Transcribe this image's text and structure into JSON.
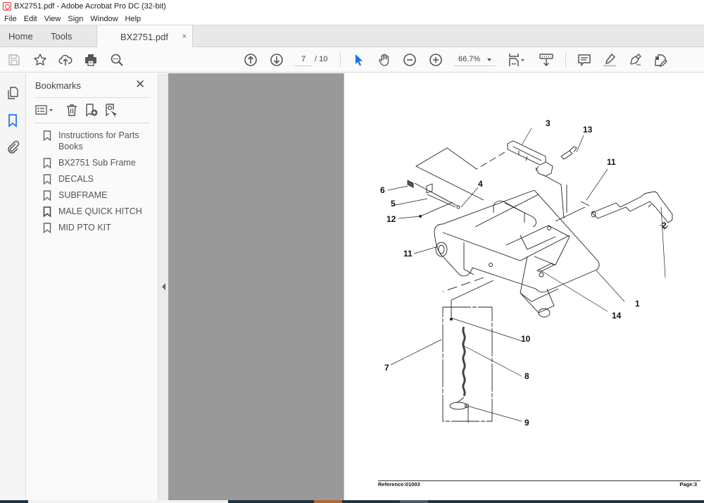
{
  "window": {
    "title": "BX2751.pdf - Adobe Acrobat Pro DC (32-bit)",
    "app_icon": "acrobat-icon"
  },
  "menu": [
    "File",
    "Edit",
    "View",
    "Sign",
    "Window",
    "Help"
  ],
  "tabs": {
    "home": "Home",
    "tools": "Tools",
    "document": "BX2751.pdf",
    "close_glyph": "×"
  },
  "toolbar": {
    "left_icons": [
      "save-icon",
      "bookmark-star-icon",
      "upload-cloud-icon",
      "print-icon",
      "find-zoom-icon"
    ],
    "page_current": "7",
    "page_total": "/ 10",
    "zoom_level": "66.7%",
    "right_icons": [
      "select-arrow-icon",
      "hand-icon",
      "zoom-out-icon",
      "zoom-in-icon",
      "page-fit-icon",
      "scroll-mode-icon",
      "comment-icon",
      "highlight-icon",
      "sign-icon",
      "edit-pdf-icon"
    ],
    "accent_color": "#1473e6"
  },
  "nav_rail": [
    "page-thumbnails-icon",
    "bookmarks-icon",
    "attachments-icon"
  ],
  "bookmarks": {
    "title": "Bookmarks",
    "close_glyph": "✕",
    "items": [
      "Instructions for Parts Books",
      "BX2751 Sub Frame",
      "DECALS",
      "SUBFRAME",
      "MALE QUICK HITCH",
      "MID PTO KIT"
    ]
  },
  "page": {
    "callouts": [
      "3",
      "13",
      "11",
      "6",
      "4",
      "5",
      "12",
      "2",
      "11",
      "1",
      "14",
      "10",
      "7",
      "8",
      "9"
    ],
    "footer_reference": "Reference:01003",
    "footer_page": "Page:3"
  }
}
